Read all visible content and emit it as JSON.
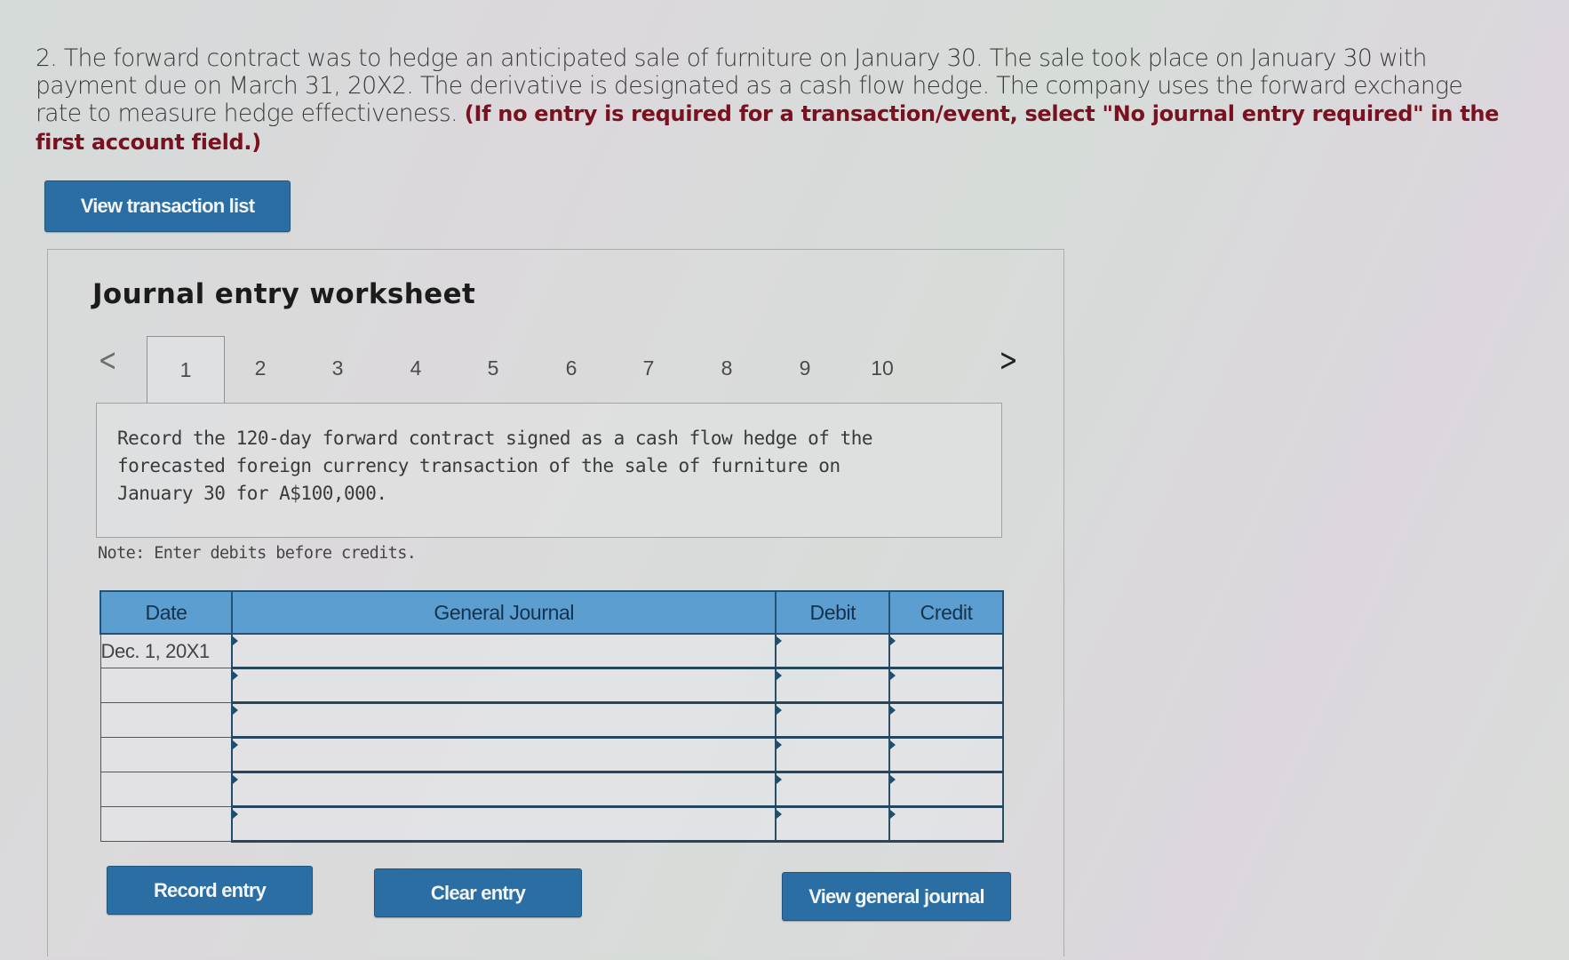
{
  "question": {
    "number": "2.",
    "text": "The forward contract was to hedge an anticipated sale of furniture on January 30. The sale took place on January 30 with payment due on March 31, 20X2. The derivative is designated as a cash flow hedge. The company uses the forward exchange rate to measure hedge effectiveness.",
    "instruction": "(If no entry is required for a transaction/event, select \"No journal entry required\" in the first account field.)"
  },
  "buttons": {
    "view_transaction_list": "View transaction list",
    "record_entry": "Record entry",
    "clear_entry": "Clear entry",
    "view_general_journal": "View general journal"
  },
  "worksheet": {
    "title": "Journal entry worksheet",
    "tabs": [
      "1",
      "2",
      "3",
      "4",
      "5",
      "6",
      "7",
      "8",
      "9",
      "10"
    ],
    "active_tab": "1",
    "prev_icon": "chevron-left-icon",
    "next_icon": "chevron-right-icon",
    "prev_glyph": "<",
    "next_glyph": ">",
    "description": "Record the 120-day forward contract signed as a cash flow hedge of the forecasted foreign currency transaction of the sale of furniture on January 30 for A$100,000.",
    "note": "Note: Enter debits before credits."
  },
  "journal_table": {
    "columns": [
      "Date",
      "General Journal",
      "Debit",
      "Credit"
    ],
    "rows": [
      {
        "date": "Dec. 1, 20X1",
        "account": "",
        "debit": "",
        "credit": ""
      },
      {
        "date": "",
        "account": "",
        "debit": "",
        "credit": ""
      },
      {
        "date": "",
        "account": "",
        "debit": "",
        "credit": ""
      },
      {
        "date": "",
        "account": "",
        "debit": "",
        "credit": ""
      },
      {
        "date": "",
        "account": "",
        "debit": "",
        "credit": ""
      },
      {
        "date": "",
        "account": "",
        "debit": "",
        "credit": ""
      }
    ]
  },
  "colors": {
    "button_bg": "#2b6ea3",
    "table_header_bg": "#5b9ecf",
    "instruction_text": "#7a1020"
  }
}
